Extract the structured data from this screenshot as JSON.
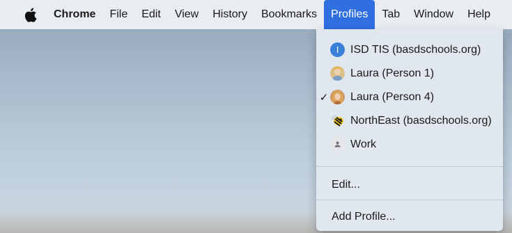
{
  "menubar": {
    "apple_icon": "apple-icon",
    "items": [
      {
        "label": "Chrome",
        "bold": true
      },
      {
        "label": "File"
      },
      {
        "label": "Edit"
      },
      {
        "label": "View"
      },
      {
        "label": "History"
      },
      {
        "label": "Bookmarks"
      },
      {
        "label": "Profiles",
        "active": true
      },
      {
        "label": "Tab"
      },
      {
        "label": "Window"
      },
      {
        "label": "Help"
      }
    ]
  },
  "profiles_menu": {
    "profiles": [
      {
        "label": "ISD TIS (basdschools.org)",
        "avatar_initial": "I",
        "checked": false
      },
      {
        "label": "Laura (Person 1)",
        "avatar": "photo-avatar",
        "checked": false
      },
      {
        "label": "Laura (Person 4)",
        "avatar": "photo-avatar",
        "checked": true,
        "check_mark": "✓"
      },
      {
        "label": "NorthEast (basdschools.org)",
        "avatar": "yellow-jacket-mascot-avatar",
        "checked": false
      },
      {
        "label": "Work",
        "avatar": "generic-person-avatar",
        "checked": false
      }
    ],
    "edit_label": "Edit...",
    "add_profile_label": "Add Profile..."
  },
  "colors": {
    "menu_highlight": "#2f6fe0",
    "menubar_bg": "#eceef2",
    "dropdown_bg": "#e2e8f0"
  }
}
